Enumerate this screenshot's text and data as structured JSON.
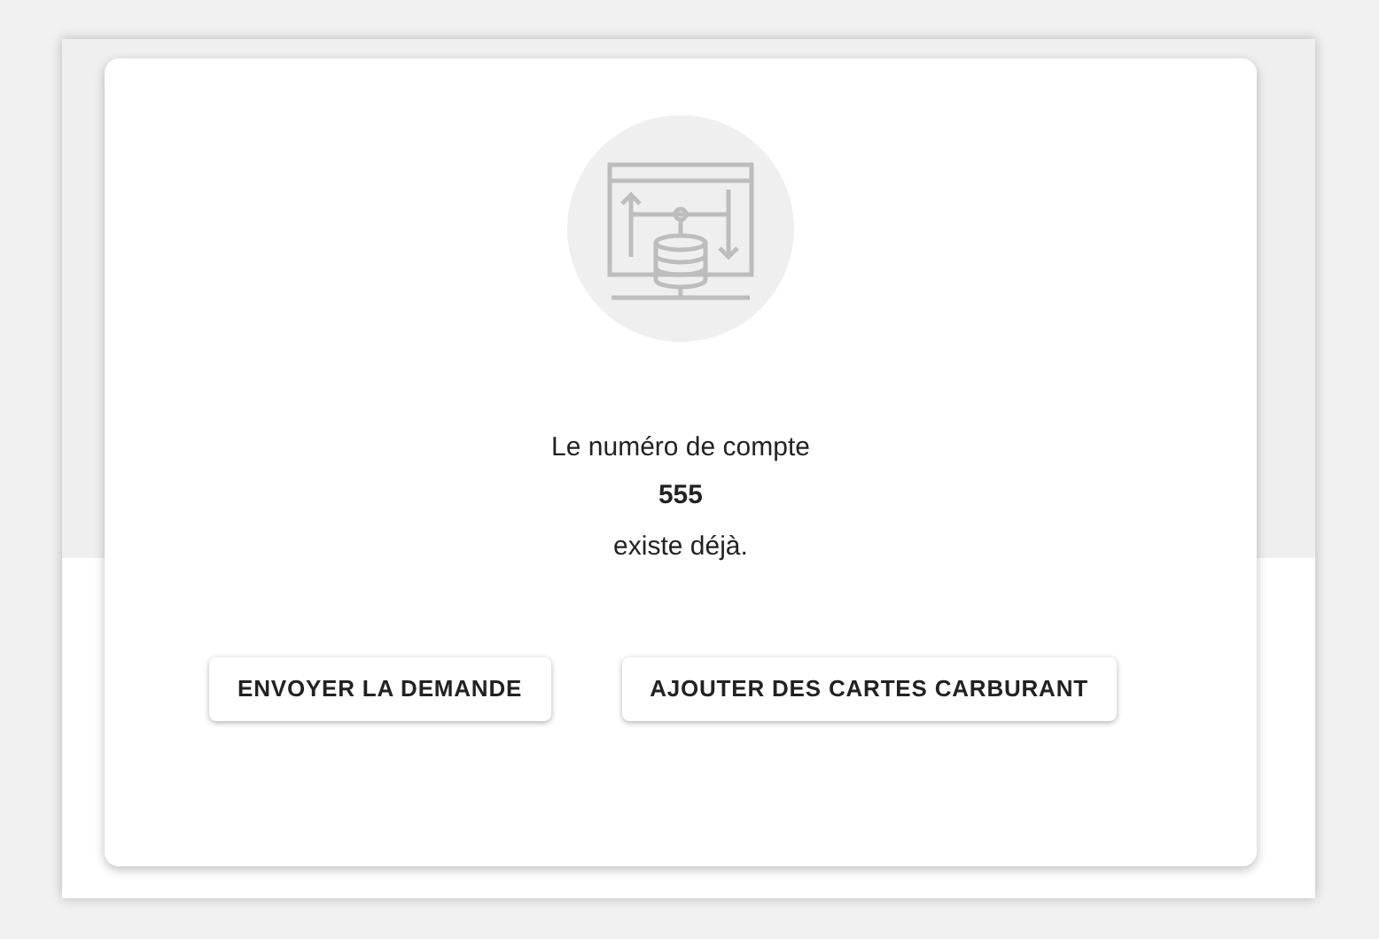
{
  "message": {
    "line_1": "Le numéro de compte",
    "account_number": "555",
    "line_2": "existe déjà."
  },
  "buttons": [
    {
      "label": "ENVOYER LA DEMANDE"
    },
    {
      "label": "AJOUTER DES CARTES CARBURANT"
    }
  ]
}
